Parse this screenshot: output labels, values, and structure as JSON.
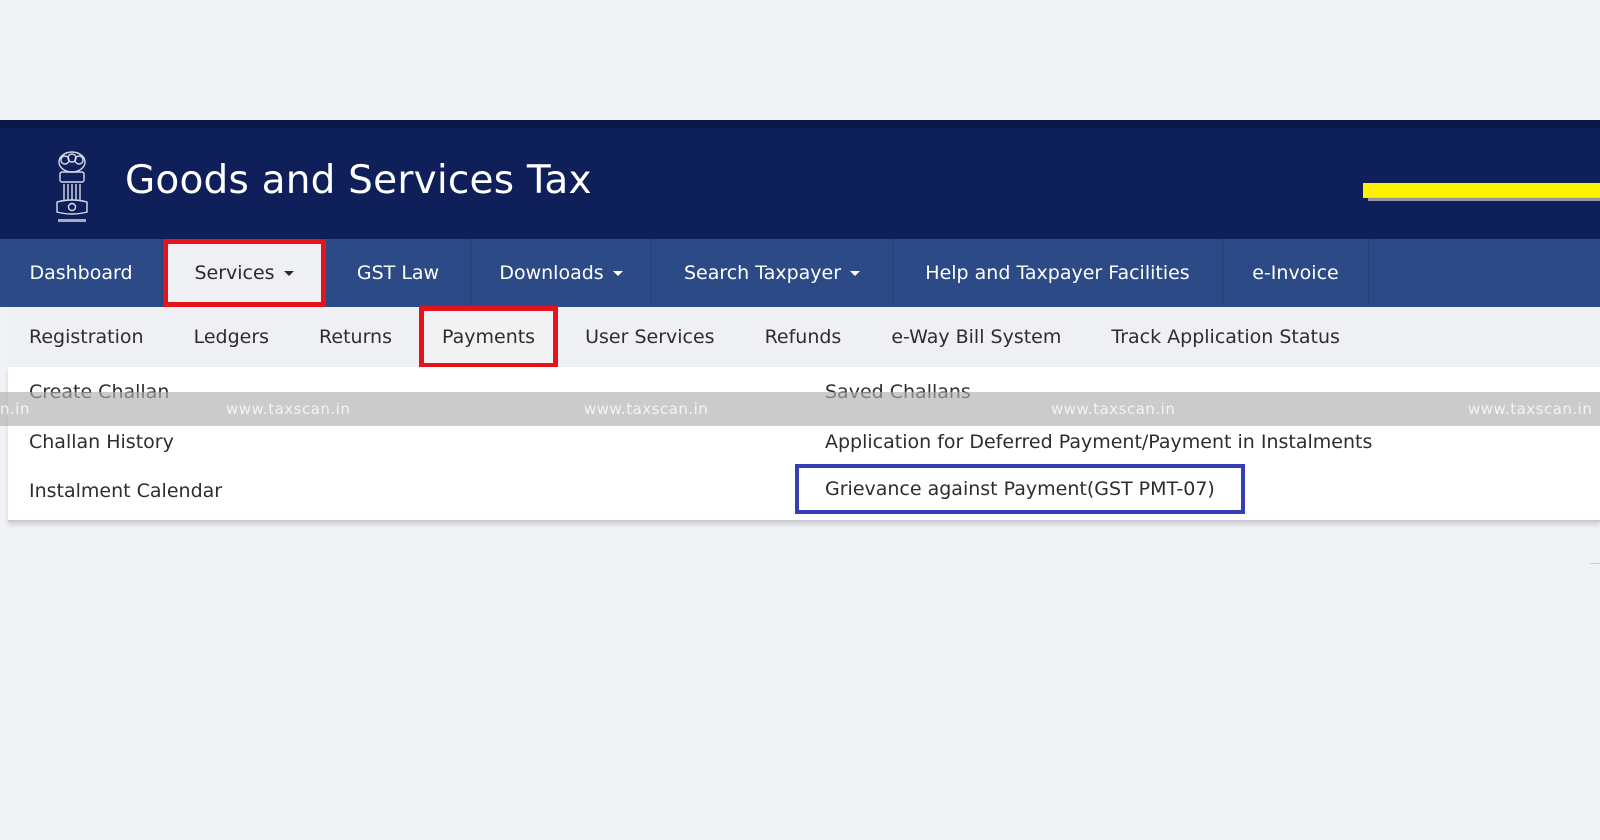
{
  "header": {
    "title": "Goods and Services Tax",
    "emblem_icon": "national-emblem-icon",
    "colors": {
      "header_bg": "#0f1f5a",
      "nav_bg": "#2c4a85",
      "highlight_red": "#e3141c",
      "highlight_blue": "#3540b8",
      "banner_yellow": "#fff200"
    }
  },
  "mainnav": {
    "items": [
      {
        "label": "Dashboard",
        "has_caret": false
      },
      {
        "label": "Services",
        "has_caret": true,
        "active": true
      },
      {
        "label": "GST Law",
        "has_caret": false
      },
      {
        "label": "Downloads",
        "has_caret": true
      },
      {
        "label": "Search Taxpayer",
        "has_caret": true
      },
      {
        "label": "Help and Taxpayer Facilities",
        "has_caret": false
      },
      {
        "label": "e-Invoice",
        "has_caret": false
      }
    ]
  },
  "subnav": {
    "items": [
      {
        "label": "Registration"
      },
      {
        "label": "Ledgers"
      },
      {
        "label": "Returns"
      },
      {
        "label": "Payments",
        "active": true
      },
      {
        "label": "User Services"
      },
      {
        "label": "Refunds"
      },
      {
        "label": "e-Way Bill System"
      },
      {
        "label": "Track Application Status"
      }
    ]
  },
  "dropdown": {
    "left_column": [
      {
        "label": "Create Challan"
      },
      {
        "label": "Challan History"
      },
      {
        "label": "Instalment Calendar"
      }
    ],
    "right_column": [
      {
        "label": "Saved Challans"
      },
      {
        "label": "Application for Deferred Payment/Payment in Instalments"
      },
      {
        "label": "Grievance against Payment(GST PMT-07)",
        "highlighted": true
      }
    ]
  },
  "watermark": {
    "text": "www.taxscan.in",
    "partial_left": "n.in"
  }
}
